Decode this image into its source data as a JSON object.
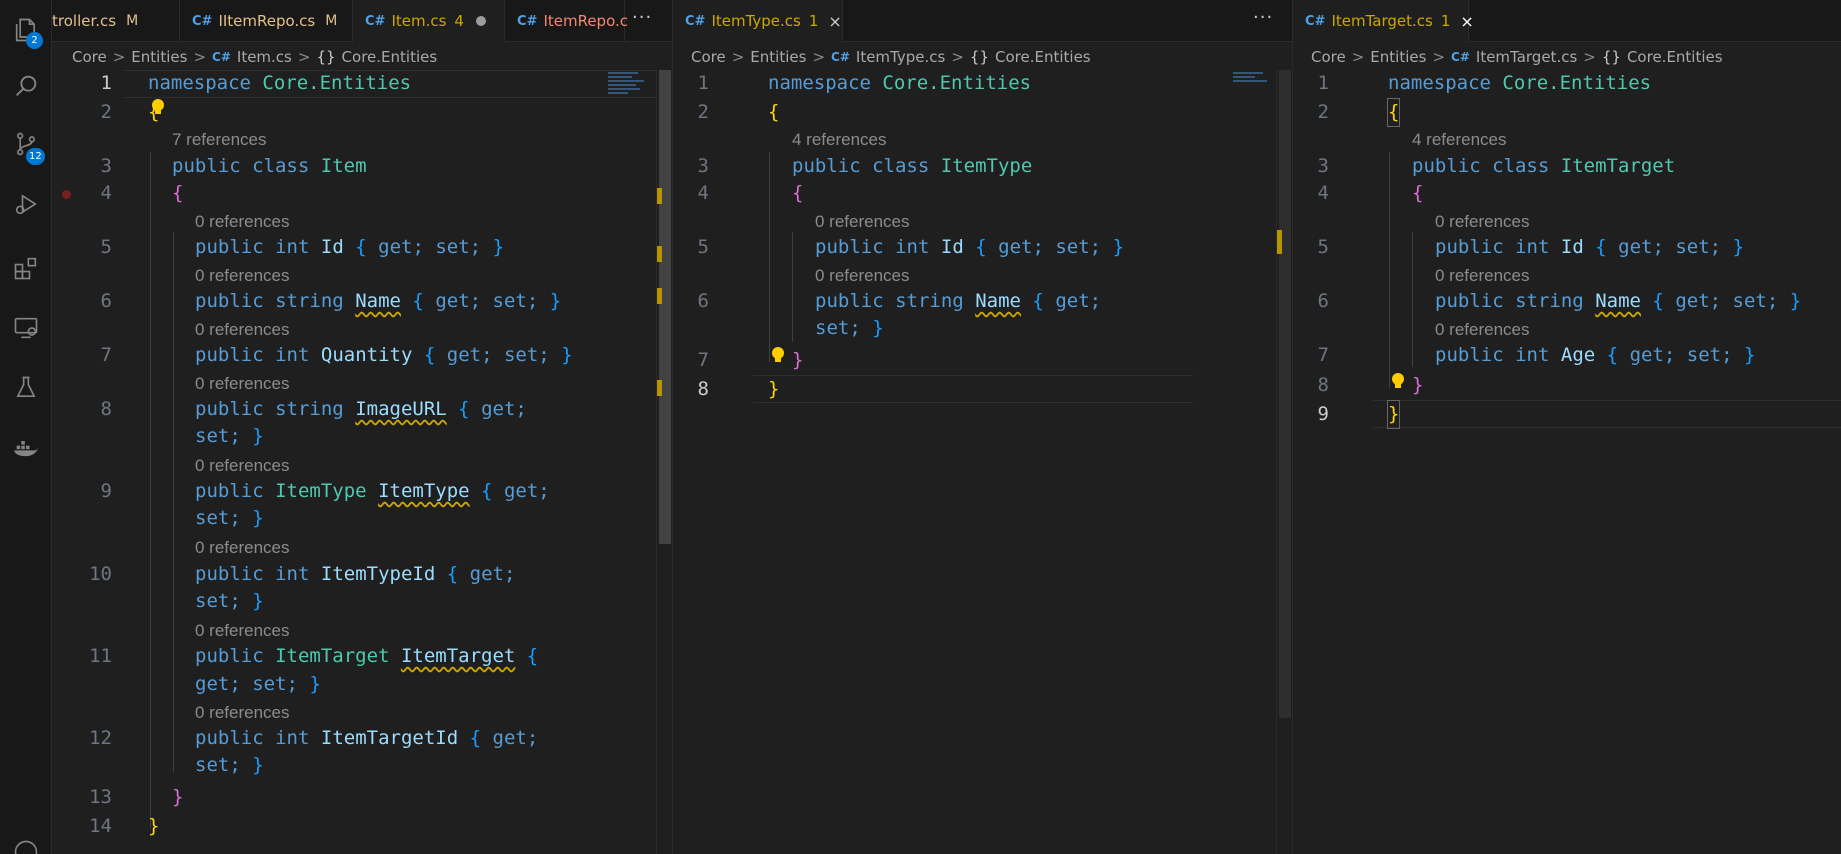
{
  "activity_bar": {
    "explorer_badge": "2",
    "scm_badge": "12"
  },
  "group1": {
    "tabs": [
      {
        "label": "troller.cs",
        "status": "M"
      },
      {
        "label": "IItemRepo.cs",
        "status": "M"
      },
      {
        "label": "Item.cs",
        "count": "4"
      },
      {
        "label": "ItemRepo.c"
      }
    ],
    "more": "···",
    "breadcrumb": [
      "Core",
      "Entities",
      "Item.cs",
      "Core.Entities"
    ],
    "line_numbers": [
      "1",
      "2",
      "3",
      "4",
      "5",
      "6",
      "7",
      "8",
      "9",
      "10",
      "11",
      "12",
      "13",
      "14"
    ],
    "lenses": {
      "class": "7 references",
      "id": "0 references",
      "name": "0 references",
      "quantity": "0 references",
      "imageurl": "0 references",
      "itemtype": "0 references",
      "itemtypeid": "0 references",
      "itemtarget": "0 references",
      "itemtargetid": "0 references"
    },
    "code": {
      "ns_kw": "namespace",
      "ns_name": "Core.Entities",
      "public": "public",
      "class": "class",
      "class_name": "Item",
      "int": "int",
      "string": "string",
      "get": "get;",
      "set": "set;",
      "id": "Id",
      "name": "Name",
      "quantity": "Quantity",
      "imageurl": "ImageURL",
      "itemtype_t": "ItemType",
      "itemtype": "ItemType",
      "itemtypeid": "ItemTypeId",
      "itemtarget_t": "ItemTarget",
      "itemtarget": "ItemTarget",
      "itemtargetid": "ItemTargetId"
    }
  },
  "group2": {
    "tab": {
      "label": "ItemType.cs",
      "count": "1"
    },
    "more": "···",
    "breadcrumb": [
      "Core",
      "Entities",
      "ItemType.cs",
      "Core.Entities"
    ],
    "line_numbers": [
      "1",
      "2",
      "3",
      "4",
      "5",
      "6",
      "7",
      "8"
    ],
    "lenses": {
      "class": "4 references",
      "id": "0 references",
      "name": "0 references"
    },
    "code": {
      "ns_kw": "namespace",
      "ns_name": "Core.Entities",
      "class_name": "ItemType",
      "id": "Id",
      "name": "Name"
    }
  },
  "group3": {
    "tab": {
      "label": "ItemTarget.cs",
      "count": "1"
    },
    "breadcrumb": [
      "Core",
      "Entities",
      "ItemTarget.cs",
      "Core.Entities"
    ],
    "line_numbers": [
      "1",
      "2",
      "3",
      "4",
      "5",
      "6",
      "7",
      "8",
      "9"
    ],
    "lenses": {
      "class": "4 references",
      "id": "0 references",
      "name": "0 references",
      "age": "0 references"
    },
    "code": {
      "ns_kw": "namespace",
      "ns_name": "Core.Entities",
      "class_name": "ItemTarget",
      "id": "Id",
      "name": "Name",
      "age": "Age"
    }
  },
  "colors": {
    "keyword": "#569cd6",
    "type": "#4ec9b0",
    "identifier": "#9cdcfe",
    "bracket_gold": "#ffd700",
    "bracket_orchid": "#da70d6",
    "bracket_blue": "#179fff",
    "accent": "#0078d4"
  },
  "icons": [
    "explorer-icon",
    "search-icon",
    "source-control-icon",
    "run-debug-icon",
    "extensions-icon",
    "remote-explorer-icon",
    "testing-icon",
    "docker-icon",
    "accounts-icon"
  ]
}
